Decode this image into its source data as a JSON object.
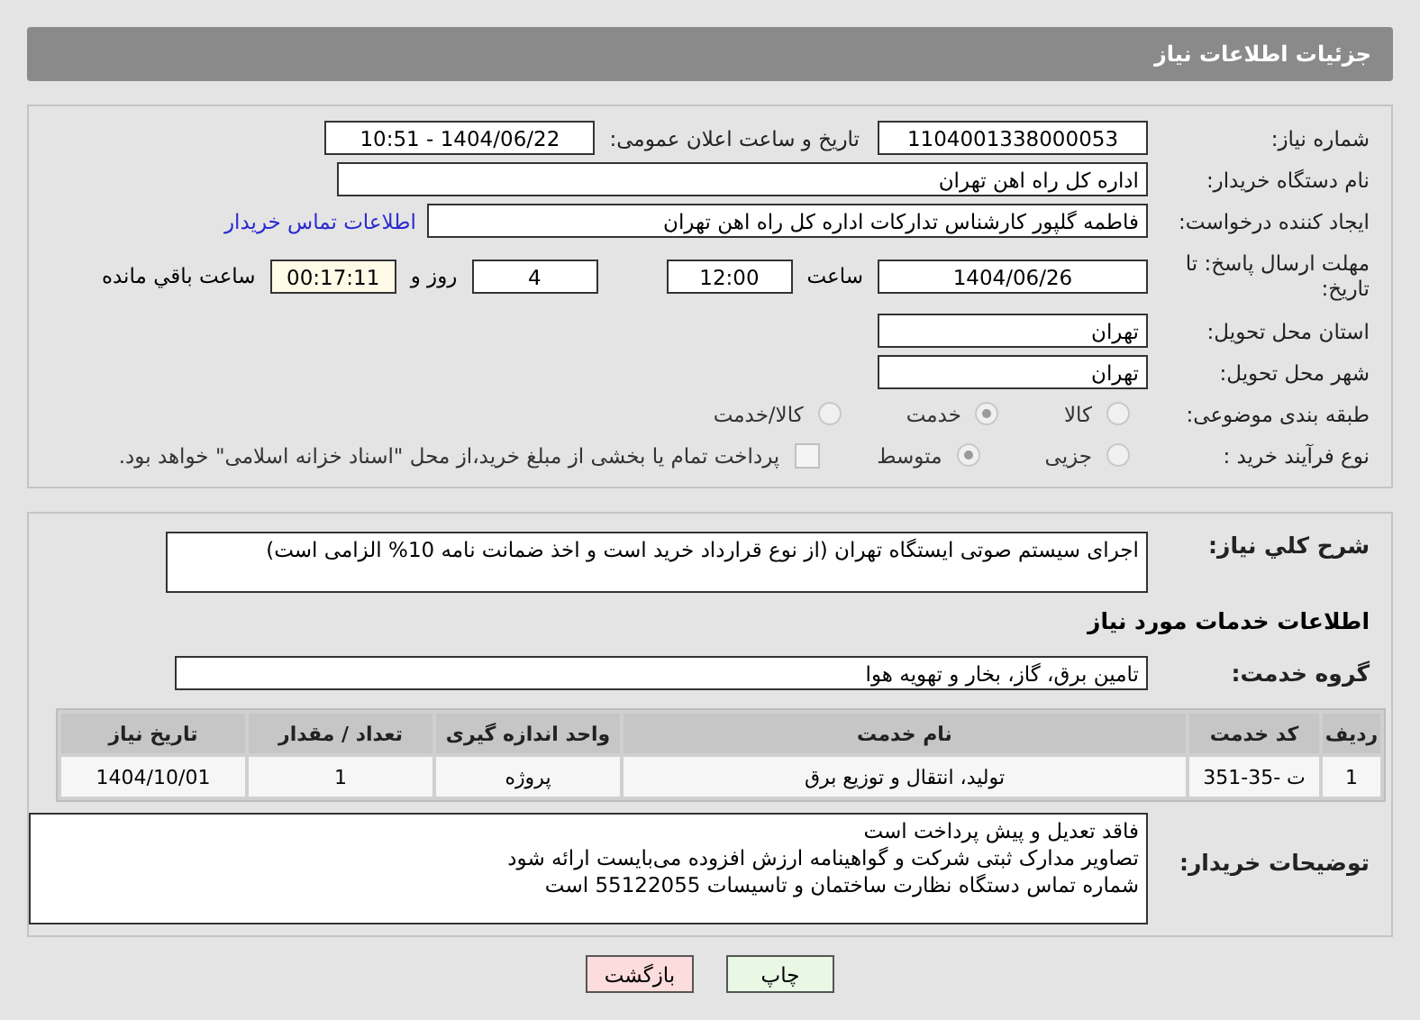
{
  "header": {
    "title": "جزئیات اطلاعات نیاز"
  },
  "need_number": {
    "label": "شماره نیاز:",
    "value": "1104001338000053"
  },
  "announce": {
    "label": "تاریخ و ساعت اعلان عمومی:",
    "value": "1404/06/22 - 10:51"
  },
  "buyer_org": {
    "label": "نام دستگاه خریدار:",
    "value": "اداره کل راه اهن تهران"
  },
  "creator": {
    "label": "ایجاد کننده درخواست:",
    "value": "فاطمه گلپور کارشناس تدارکات اداره کل راه اهن تهران",
    "link": "اطلاعات تماس خریدار"
  },
  "deadline": {
    "label": "مهلت ارسال پاسخ: تا تاریخ:",
    "date": "1404/06/26",
    "time_label": "ساعت",
    "time": "12:00",
    "days": "4",
    "days_label": "روز و",
    "remaining": "00:17:11",
    "remaining_label": "ساعت باقي مانده"
  },
  "province": {
    "label": "استان محل تحویل:",
    "value": "تهران"
  },
  "city": {
    "label": "شهر محل تحویل:",
    "value": "تهران"
  },
  "category": {
    "label": "طبقه بندی موضوعی:",
    "options": [
      {
        "label": "کالا",
        "selected": false
      },
      {
        "label": "خدمت",
        "selected": true
      },
      {
        "label": "کالا/خدمت",
        "selected": false
      }
    ]
  },
  "purchase_type": {
    "label": "نوع فرآیند خرید :",
    "options": [
      {
        "label": "جزیی",
        "selected": false
      },
      {
        "label": "متوسط",
        "selected": true
      }
    ],
    "payment": {
      "label": "پرداخت تمام یا بخشی از مبلغ خرید،از محل \"اسناد خزانه اسلامی\" خواهد بود.",
      "checked": false
    }
  },
  "description": {
    "label": "شرح کلي نياز:",
    "value": "اجرای سیستم صوتی ایستگاه تهران (از نوع قرارداد خرید است و اخذ ضمانت نامه 10% الزامی است)"
  },
  "services_heading": "اطلاعات خدمات مورد نیاز",
  "service_group": {
    "label": "گروه خدمت:",
    "value": "تامین برق، گاز، بخار و تهویه هوا"
  },
  "table": {
    "columns": [
      "ردیف",
      "کد خدمت",
      "نام خدمت",
      "واحد اندازه گیری",
      "تعداد / مقدار",
      "تاریخ نیاز"
    ],
    "rows": [
      [
        "1",
        "ت -35-351",
        "تولید، انتقال و توزیع برق",
        "پروژه",
        "1",
        "1404/10/01"
      ]
    ]
  },
  "buyer_notes": {
    "label": "توضیحات خریدار:",
    "lines": [
      "فاقد تعدیل و پیش پرداخت است",
      "تصاویر مدارک ثبتی شرکت و گواهینامه ارزش افزوده می‌بایست ارائه شود",
      "شماره تماس دستگاه نظارت ساختمان و تاسیسات 55122055 است"
    ]
  },
  "buttons": [
    {
      "label": "چاپ",
      "kind": "print"
    },
    {
      "label": "بازگشت",
      "kind": "back"
    }
  ]
}
